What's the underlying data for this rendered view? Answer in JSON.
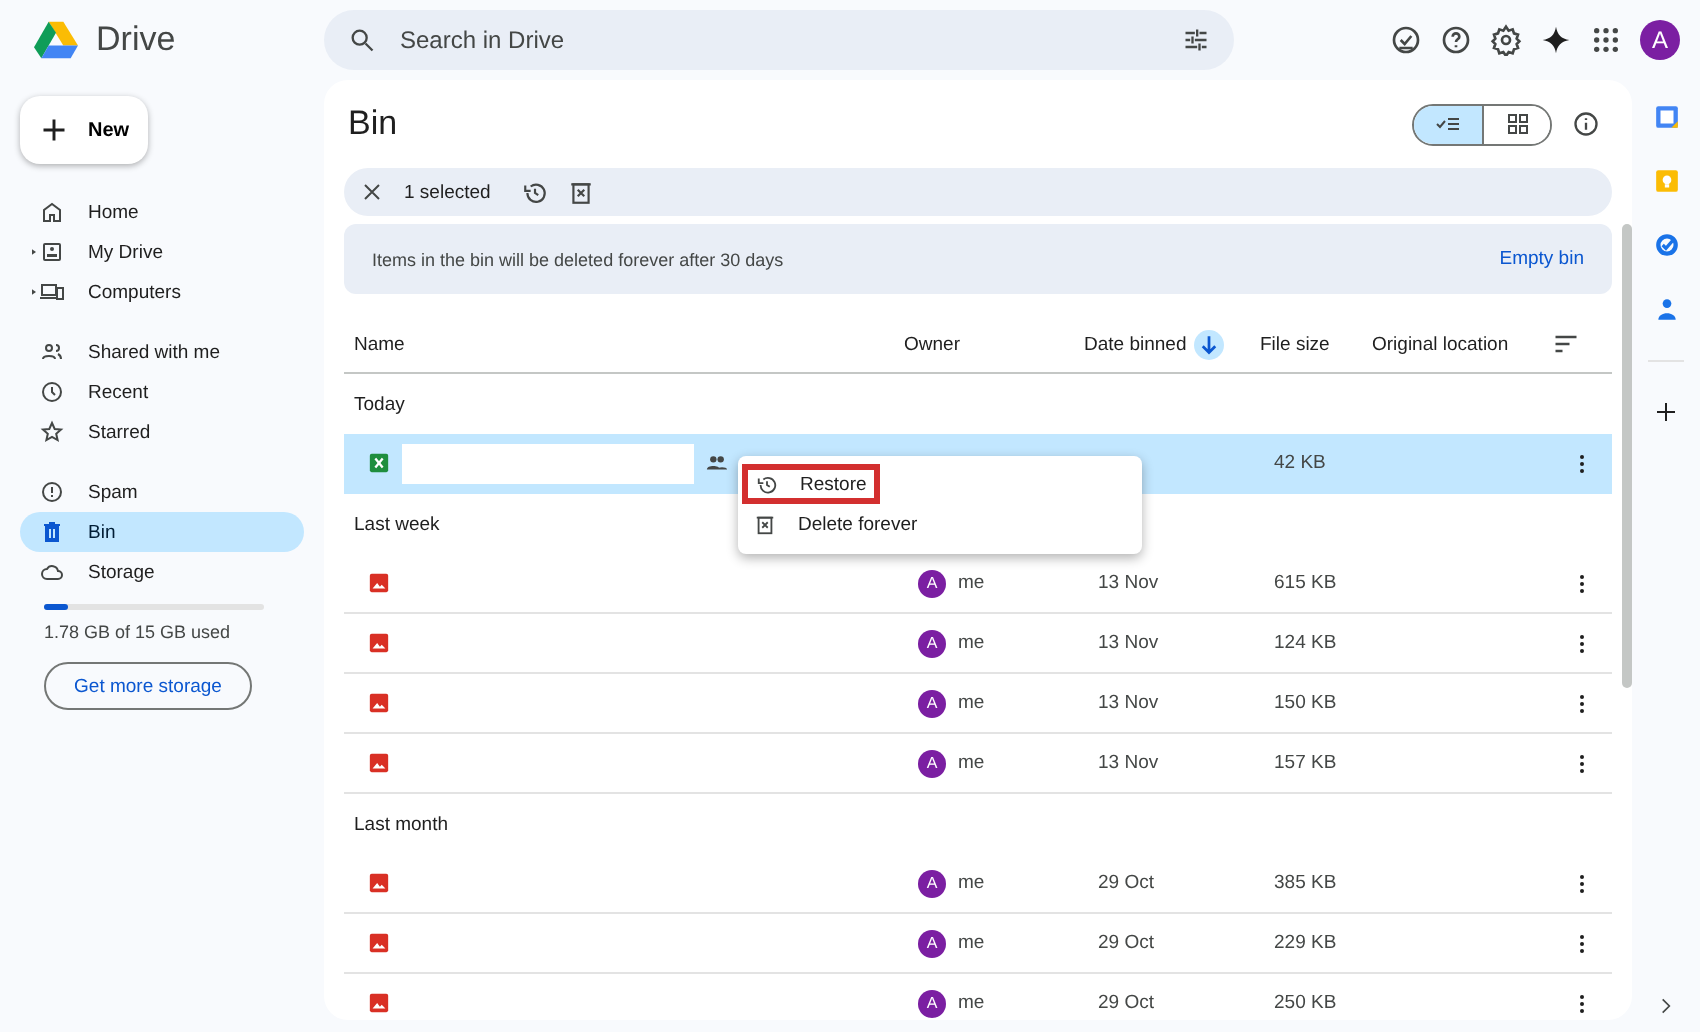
{
  "app": {
    "name": "Drive"
  },
  "search": {
    "placeholder": "Search in Drive"
  },
  "account": {
    "initial": "A"
  },
  "new_button": "New",
  "sidebar": {
    "items": [
      {
        "label": "Home",
        "expandable": false,
        "selected": false
      },
      {
        "label": "My Drive",
        "expandable": true,
        "selected": false
      },
      {
        "label": "Computers",
        "expandable": true,
        "selected": false
      },
      {
        "label": "Shared with me",
        "expandable": false,
        "selected": false
      },
      {
        "label": "Recent",
        "expandable": false,
        "selected": false
      },
      {
        "label": "Starred",
        "expandable": false,
        "selected": false
      },
      {
        "label": "Spam",
        "expandable": false,
        "selected": false
      },
      {
        "label": "Bin",
        "expandable": false,
        "selected": true
      },
      {
        "label": "Storage",
        "expandable": false,
        "selected": false
      }
    ],
    "storage": {
      "level": 0.11,
      "text": "1.78 GB of 15 GB used",
      "button": "Get more storage"
    }
  },
  "page": {
    "title": "Bin",
    "view_toggle": [
      {
        "selected": true
      },
      {
        "selected": false
      }
    ]
  },
  "selection_bar": {
    "count": "1 selected"
  },
  "banner": {
    "text": "Items in the bin will be deleted forever after 30 days",
    "action": "Empty bin"
  },
  "table": {
    "columns": [
      "Name",
      "Owner",
      "Date binned",
      "File size",
      "Original location"
    ],
    "groups": [
      {
        "label": "Today",
        "rows": [
          {
            "kind": "sheet",
            "shared": true,
            "selected": true,
            "size": "42 KB"
          }
        ]
      },
      {
        "label": "Last week",
        "rows": [
          {
            "kind": "image",
            "shared": false,
            "selected": false,
            "owner": "me",
            "avatar": "A",
            "date": "13 Nov",
            "size": "615 KB"
          },
          {
            "kind": "image",
            "shared": false,
            "selected": false,
            "owner": "me",
            "avatar": "A",
            "date": "13 Nov",
            "size": "124 KB"
          },
          {
            "kind": "image",
            "shared": false,
            "selected": false,
            "owner": "me",
            "avatar": "A",
            "date": "13 Nov",
            "size": "150 KB"
          },
          {
            "kind": "image",
            "shared": false,
            "selected": false,
            "owner": "me",
            "avatar": "A",
            "date": "13 Nov",
            "size": "157 KB"
          }
        ]
      },
      {
        "label": "Last month",
        "rows": [
          {
            "kind": "image",
            "shared": false,
            "selected": false,
            "owner": "me",
            "avatar": "A",
            "date": "29 Oct",
            "size": "385 KB"
          },
          {
            "kind": "image",
            "shared": false,
            "selected": false,
            "owner": "me",
            "avatar": "A",
            "date": "29 Oct",
            "size": "229 KB"
          },
          {
            "kind": "image",
            "shared": false,
            "selected": false,
            "owner": "me",
            "avatar": "A",
            "date": "29 Oct",
            "size": "250 KB"
          }
        ]
      }
    ]
  },
  "context_menu": {
    "items": [
      {
        "label": "Restore",
        "highlighted": true
      },
      {
        "label": "Delete forever",
        "highlighted": false
      }
    ]
  }
}
